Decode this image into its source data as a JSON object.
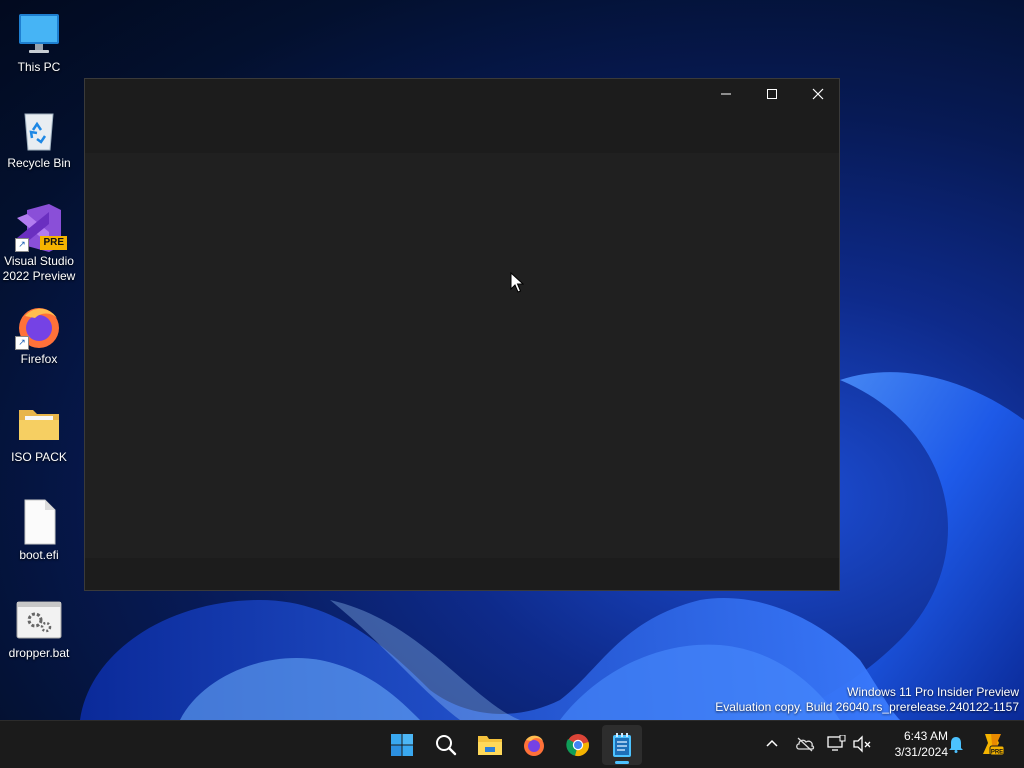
{
  "desktop": {
    "icons": [
      {
        "label": "This PC",
        "icon": "this-pc-icon"
      },
      {
        "label": "Recycle Bin",
        "icon": "recycle-bin-icon"
      },
      {
        "label": "Visual Studio 2022 Preview",
        "icon": "visual-studio-icon",
        "badge": "PRE"
      },
      {
        "label": "Firefox",
        "icon": "firefox-icon"
      },
      {
        "label": "ISO PACK",
        "icon": "folder-icon"
      },
      {
        "label": "boot.efi",
        "icon": "file-icon"
      },
      {
        "label": "dropper.bat",
        "icon": "batch-file-icon"
      }
    ]
  },
  "window": {
    "controls": [
      "minimize-icon",
      "maximize-icon",
      "close-icon"
    ]
  },
  "watermark": {
    "line1": "Windows 11 Pro Insider Preview",
    "line2": "Evaluation copy. Build 26040.rs_prerelease.240122-1157"
  },
  "taskbar": {
    "apps": [
      "start-icon",
      "search-icon",
      "file-explorer-icon",
      "firefox-icon",
      "chrome-icon",
      "notepad-icon"
    ],
    "active_app": "notepad-icon",
    "tray": [
      "show-hidden-icons-chevron",
      "onedrive-offline-icon",
      "network-icon",
      "volume-muted-icon"
    ],
    "time": "6:43 AM",
    "date": "3/31/2024",
    "accent": "#4cc2ff"
  }
}
